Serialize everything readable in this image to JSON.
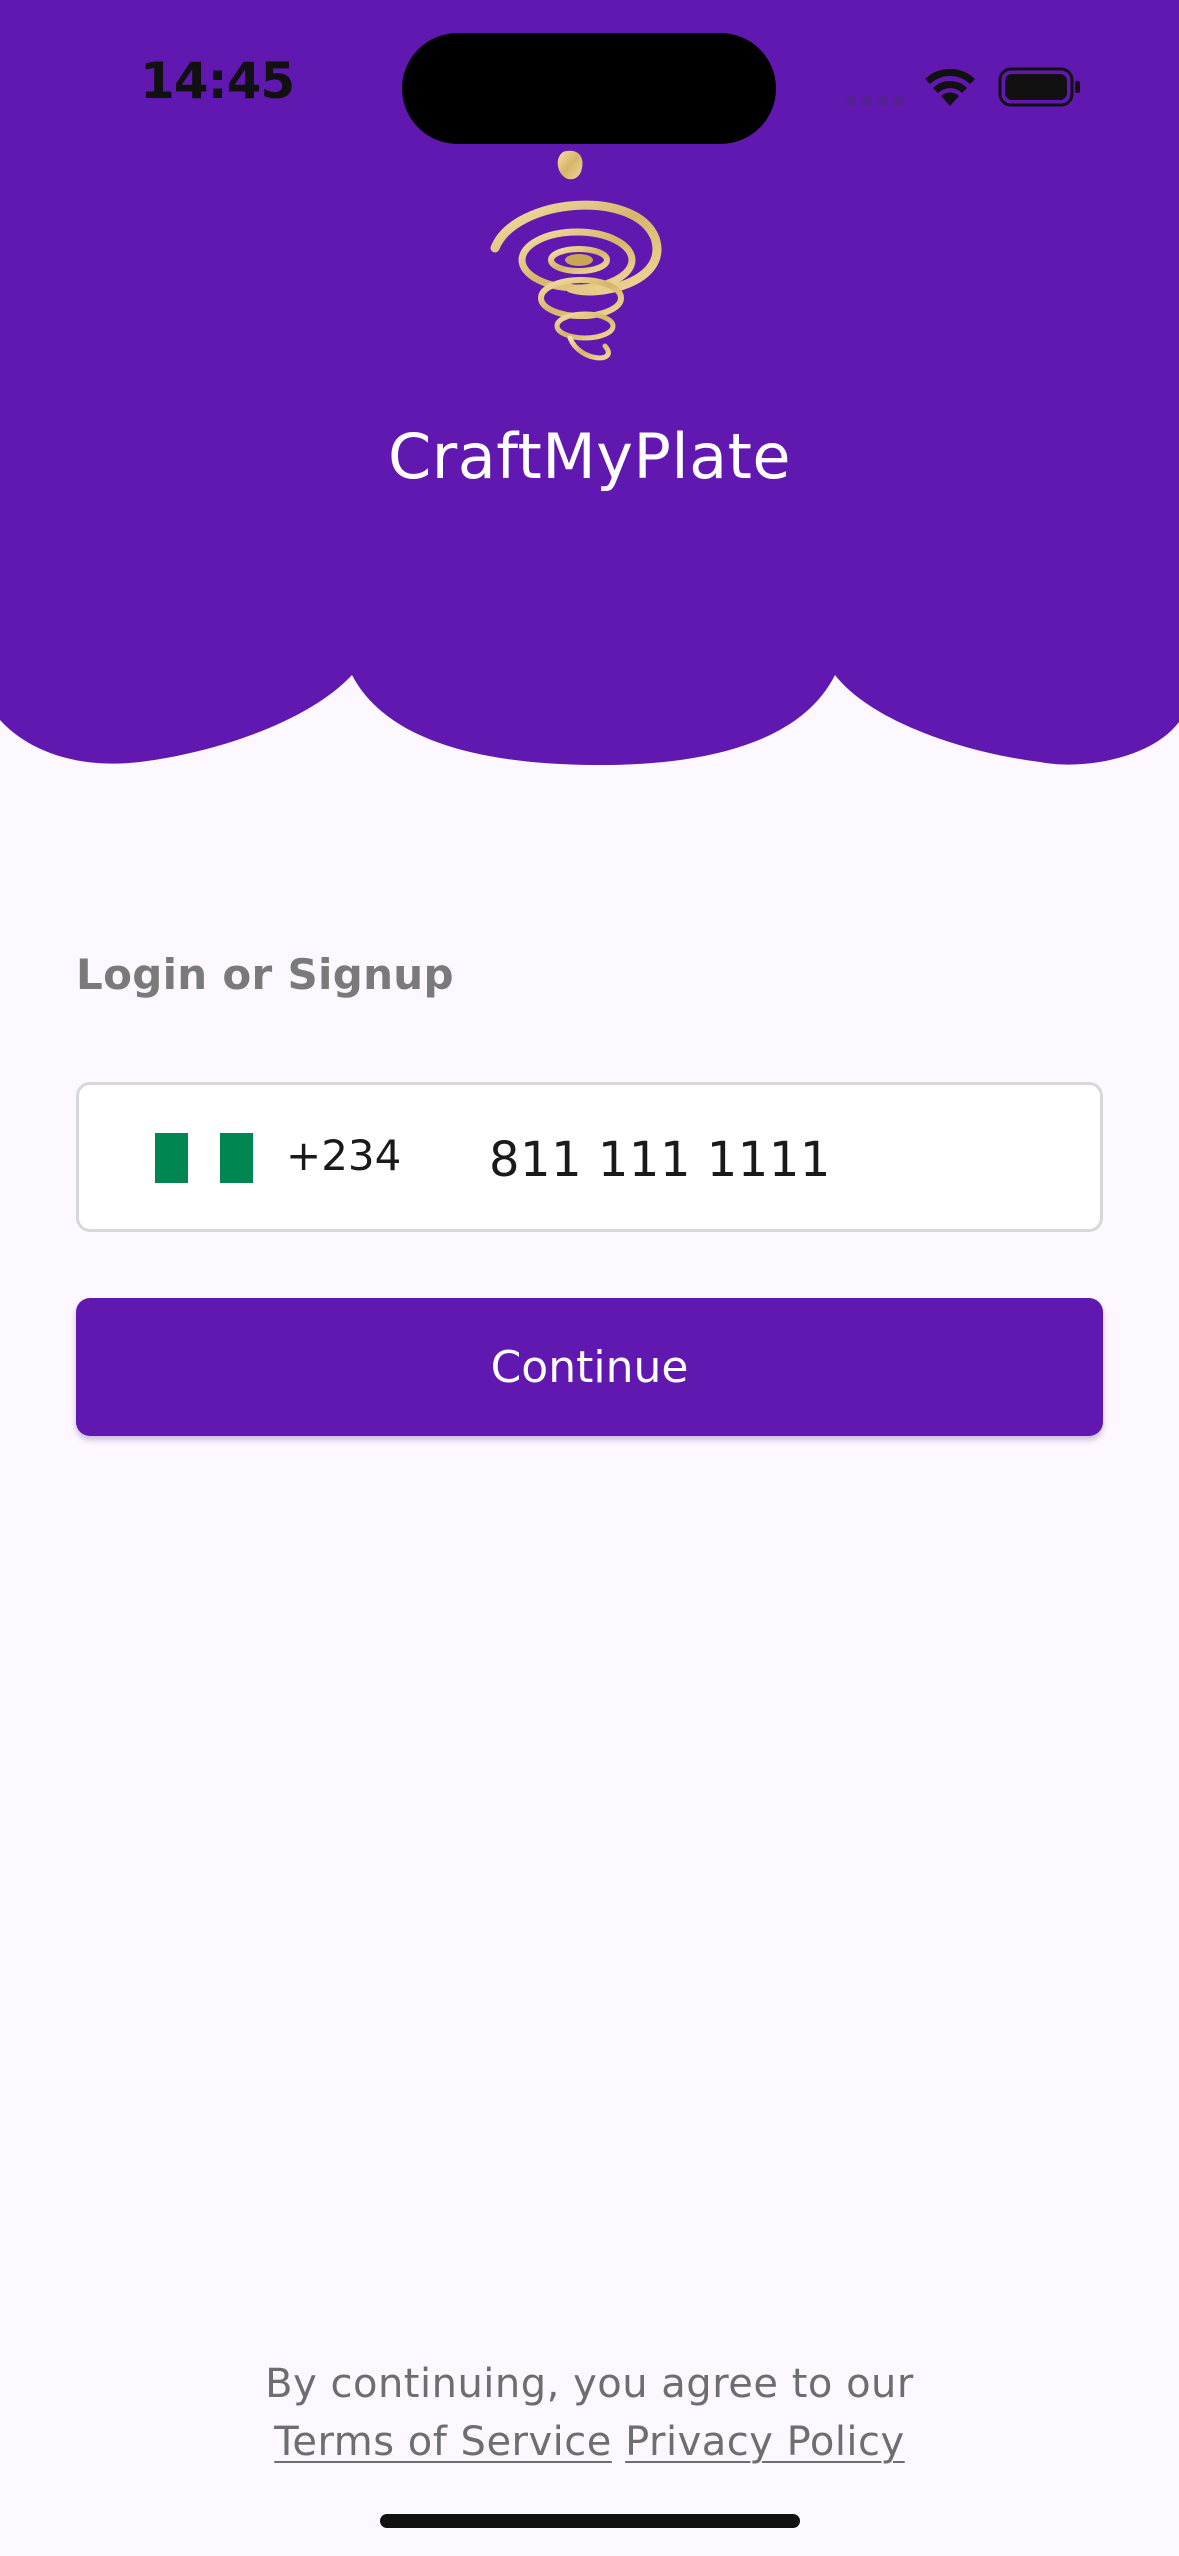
{
  "status_bar": {
    "time": "14:45"
  },
  "app": {
    "name": "CraftMyPlate"
  },
  "login": {
    "label": "Login or Signup",
    "country_code": "+234",
    "flag_colors": [
      "#008751",
      "#ffffff",
      "#008751"
    ],
    "phone_value": "811 111 1111",
    "continue_label": "Continue"
  },
  "footer": {
    "agreement_text": "By continuing, you agree to our",
    "terms_label": "Terms of Service",
    "privacy_label": "Privacy Policy"
  },
  "colors": {
    "brand_purple": "#6118b0",
    "logo_gold": "#e2c47f",
    "background": "#fdf7ff"
  }
}
